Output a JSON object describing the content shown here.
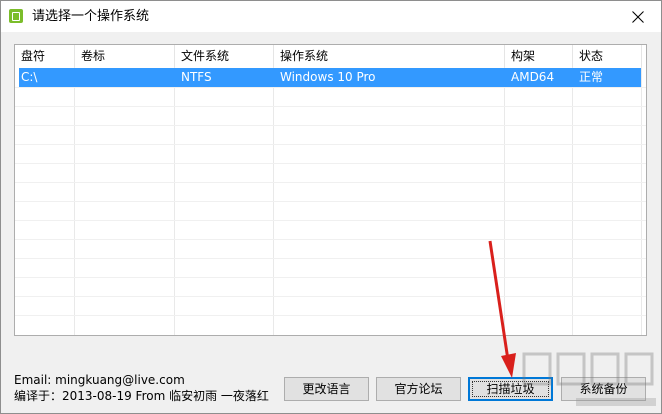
{
  "window": {
    "title": "请选择一个操作系统"
  },
  "list": {
    "columns": [
      "盘符",
      "卷标",
      "文件系统",
      "操作系统",
      "构架",
      "状态"
    ],
    "rows": [
      {
        "drive": "C:\\",
        "label": "",
        "fs": "NTFS",
        "os": "Windows 10 Pro",
        "arch": "AMD64",
        "status": "正常"
      }
    ]
  },
  "footer": {
    "email": "Email:  mingkuang@live.com",
    "compiled": "编译于：2013-08-19 From 临安初雨 一夜落红"
  },
  "buttons": {
    "change_language": "更改语言",
    "forum": "官方论坛",
    "scan_junk": "扫描垃圾",
    "system_backup": "系统备份"
  },
  "colors": {
    "selection": "#3399ff",
    "arrow": "#d9201c",
    "app_icon": "#7bbd2a"
  },
  "icons": {
    "app": "app-icon",
    "close": "close-icon"
  }
}
